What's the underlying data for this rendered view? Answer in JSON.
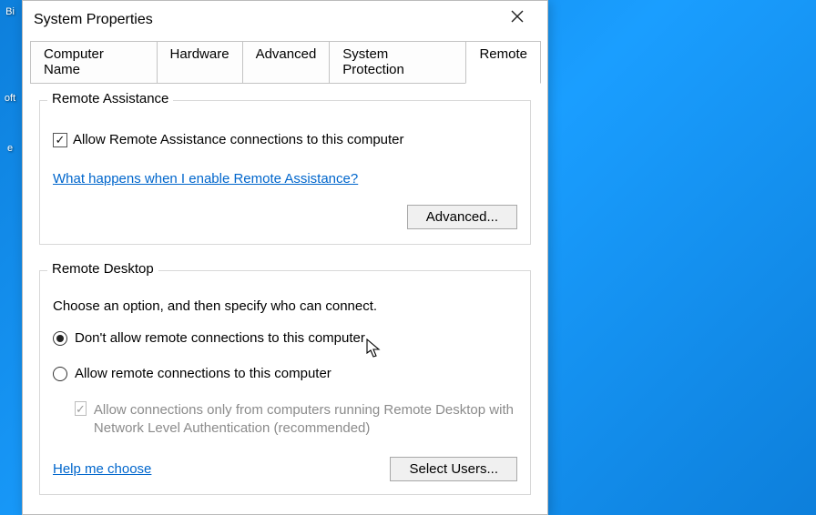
{
  "desktop": {
    "icon1_label": "Bi",
    "icon2_label": "oft",
    "icon3_label": "e"
  },
  "window": {
    "title": "System Properties"
  },
  "tabs": {
    "t0": "Computer Name",
    "t1": "Hardware",
    "t2": "Advanced",
    "t3": "System Protection",
    "t4": "Remote"
  },
  "remote_assistance": {
    "legend": "Remote Assistance",
    "allow_label": "Allow Remote Assistance connections to this computer",
    "link": "What happens when I enable Remote Assistance?",
    "advanced_btn": "Advanced..."
  },
  "remote_desktop": {
    "legend": "Remote Desktop",
    "intro": "Choose an option, and then specify who can connect.",
    "opt_dont": "Don't allow remote connections to this computer",
    "opt_allow": "Allow remote connections to this computer",
    "nla": "Allow connections only from computers running Remote Desktop with Network Level Authentication (recommended)",
    "help_link": "Help me choose",
    "select_users_btn": "Select Users..."
  }
}
